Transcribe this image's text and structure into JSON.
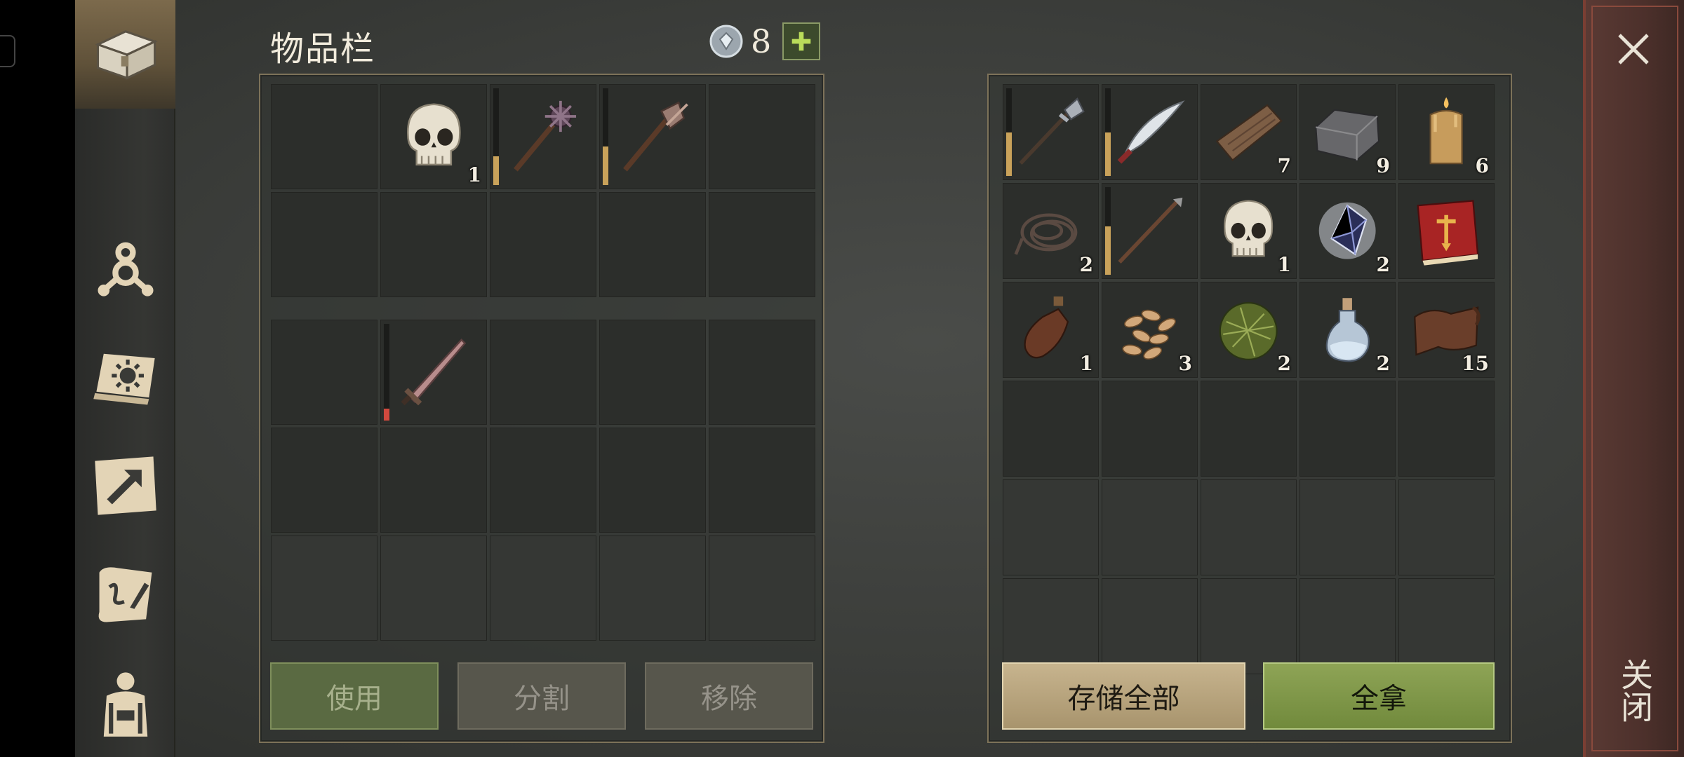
{
  "inventory": {
    "title": "物品栏",
    "currency": {
      "icon": "gem-icon",
      "amount": "8",
      "add_icon": "plus-icon"
    },
    "sidebar": [
      {
        "name": "chest",
        "icon": "chest-icon",
        "active": true
      },
      {
        "name": "skills",
        "icon": "skill-tree-icon"
      },
      {
        "name": "tome",
        "icon": "sun-book-icon"
      },
      {
        "name": "map",
        "icon": "map-arrow-icon"
      },
      {
        "name": "scroll",
        "icon": "quill-scroll-icon"
      },
      {
        "name": "character",
        "icon": "backpack-character-icon"
      }
    ],
    "player_slots": [
      {
        "icon": "",
        "count": ""
      },
      {
        "icon": "skull-icon",
        "count": "1"
      },
      {
        "icon": "spiked-mace-icon",
        "count": "",
        "durability": 0.3
      },
      {
        "icon": "flanged-mace-icon",
        "count": "",
        "durability": 0.4
      },
      {
        "icon": "",
        "count": ""
      },
      {
        "icon": "",
        "count": ""
      },
      {
        "icon": "",
        "count": ""
      },
      {
        "icon": "",
        "count": ""
      },
      {
        "icon": "",
        "count": ""
      },
      {
        "icon": "",
        "count": ""
      }
    ],
    "backpack_slots": [
      {
        "icon": "",
        "count": ""
      },
      {
        "icon": "sword-icon",
        "count": "",
        "durability": 0.12,
        "durability_color": "red"
      },
      {
        "icon": "",
        "count": ""
      },
      {
        "icon": "",
        "count": ""
      },
      {
        "icon": "",
        "count": ""
      },
      {
        "icon": "",
        "count": ""
      },
      {
        "icon": "",
        "count": ""
      },
      {
        "icon": "",
        "count": ""
      },
      {
        "icon": "",
        "count": ""
      },
      {
        "icon": "",
        "count": ""
      },
      {
        "icon": "",
        "count": "",
        "dim": true
      },
      {
        "icon": "",
        "count": "",
        "dim": true
      },
      {
        "icon": "",
        "count": "",
        "dim": true
      },
      {
        "icon": "",
        "count": "",
        "dim": true
      },
      {
        "icon": "",
        "count": "",
        "dim": true
      }
    ],
    "container_slots": [
      {
        "icon": "halberd-icon",
        "count": "",
        "durability": 0.5
      },
      {
        "icon": "scimitar-icon",
        "count": "",
        "durability": 0.5
      },
      {
        "icon": "wood-plank-icon",
        "count": "7"
      },
      {
        "icon": "stone-block-icon",
        "count": "9"
      },
      {
        "icon": "candle-icon",
        "count": "6"
      },
      {
        "icon": "rope-icon",
        "count": "2"
      },
      {
        "icon": "spear-icon",
        "count": "",
        "durability": 0.55
      },
      {
        "icon": "skull-icon",
        "count": "1"
      },
      {
        "icon": "crystal-icon",
        "count": "2"
      },
      {
        "icon": "red-book-icon",
        "count": ""
      },
      {
        "icon": "bottle-icon",
        "count": "1"
      },
      {
        "icon": "seeds-icon",
        "count": "3"
      },
      {
        "icon": "herb-ball-icon",
        "count": "2"
      },
      {
        "icon": "potion-flask-icon",
        "count": "2"
      },
      {
        "icon": "leather-scroll-icon",
        "count": "15"
      },
      {
        "icon": "",
        "count": ""
      },
      {
        "icon": "",
        "count": ""
      },
      {
        "icon": "",
        "count": ""
      },
      {
        "icon": "",
        "count": ""
      },
      {
        "icon": "",
        "count": ""
      },
      {
        "icon": "",
        "count": "",
        "dim": true
      },
      {
        "icon": "",
        "count": "",
        "dim": true
      },
      {
        "icon": "",
        "count": "",
        "dim": true
      },
      {
        "icon": "",
        "count": "",
        "dim": true
      },
      {
        "icon": "",
        "count": "",
        "dim": true
      },
      {
        "icon": "",
        "count": "",
        "dim": true
      },
      {
        "icon": "",
        "count": "",
        "dim": true
      },
      {
        "icon": "",
        "count": "",
        "dim": true
      },
      {
        "icon": "",
        "count": "",
        "dim": true
      },
      {
        "icon": "",
        "count": "",
        "dim": true
      }
    ],
    "buttons": {
      "use": "使用",
      "split": "分割",
      "remove": "移除",
      "store_all": "存储全部",
      "take_all": "全拿"
    },
    "close": {
      "icon": "close-icon",
      "label": "关闭"
    }
  }
}
